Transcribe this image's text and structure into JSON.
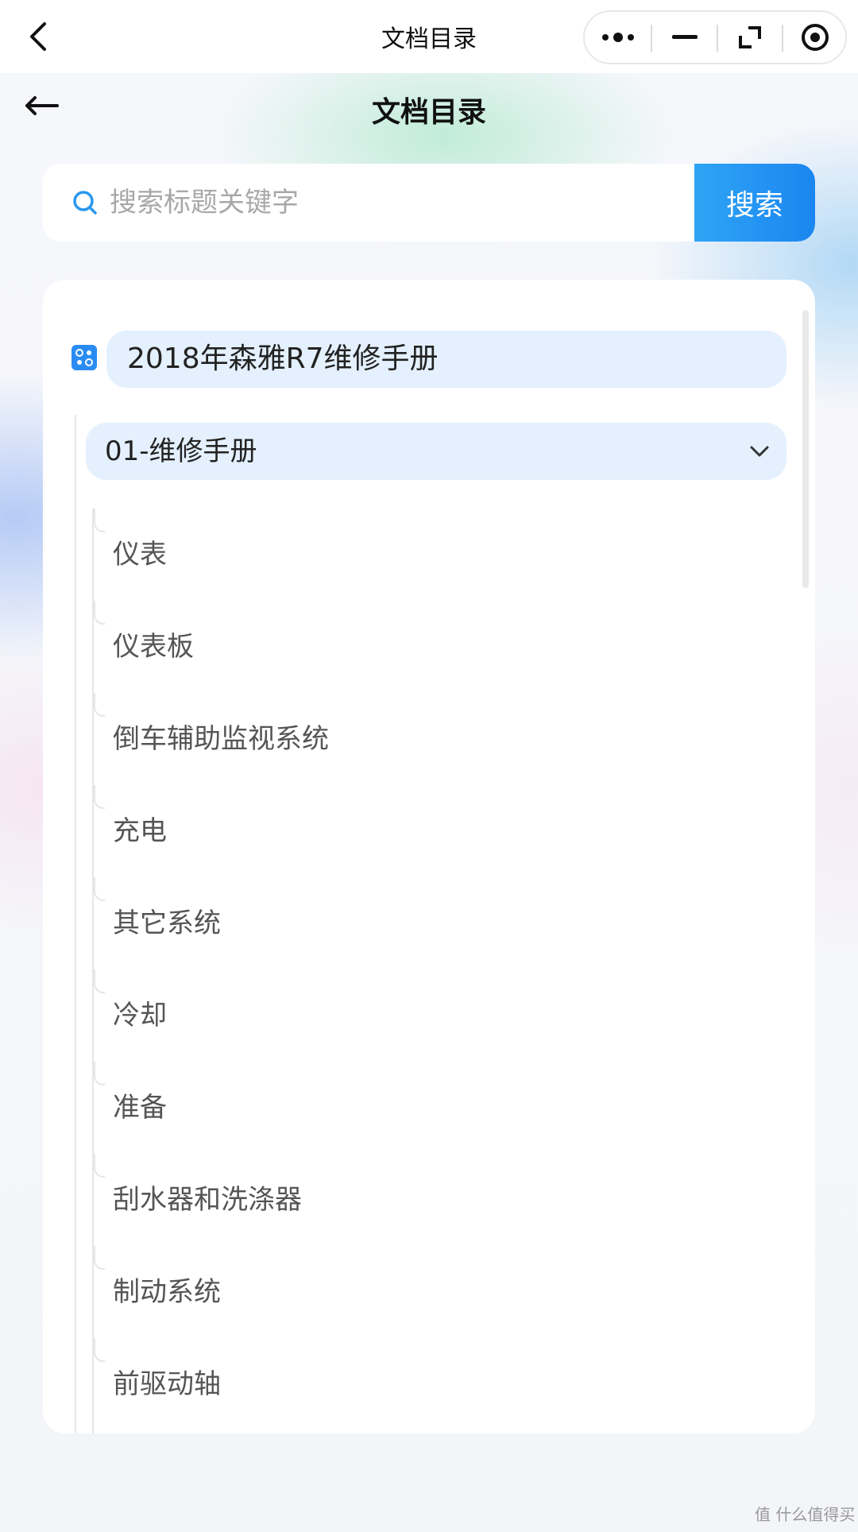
{
  "window": {
    "title": "文档目录"
  },
  "page": {
    "heading": "文档目录"
  },
  "search": {
    "placeholder": "搜索标题关键字",
    "button_label": "搜索"
  },
  "tree": {
    "root_label": "2018年森雅R7维修手册",
    "chapter_label": "01-维修手册",
    "items": [
      {
        "label": "仪表"
      },
      {
        "label": "仪表板"
      },
      {
        "label": "倒车辅助监视系统"
      },
      {
        "label": "充电"
      },
      {
        "label": "其它系统"
      },
      {
        "label": "冷却"
      },
      {
        "label": "准备"
      },
      {
        "label": "刮水器和洗涤器"
      },
      {
        "label": "制动系统"
      },
      {
        "label": "前驱动轴"
      }
    ]
  },
  "watermark": {
    "text": "值 什么值得买"
  },
  "colors": {
    "accent": "#1a86f0",
    "selected_bg": "#e4f0fd"
  }
}
